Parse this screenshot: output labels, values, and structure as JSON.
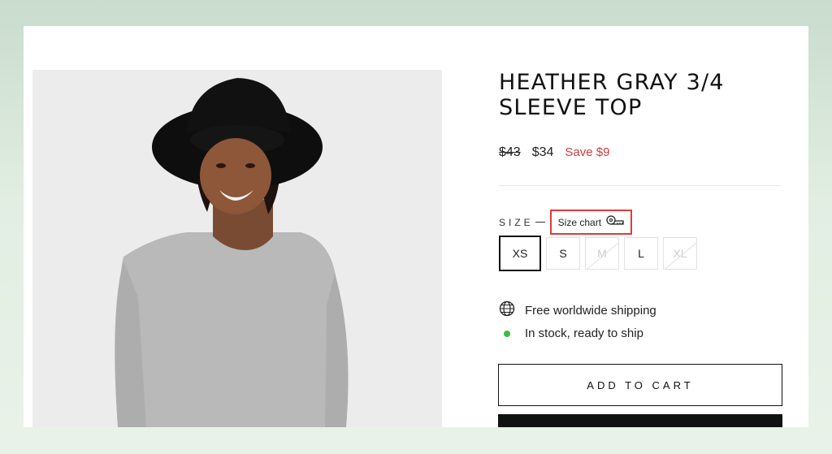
{
  "product": {
    "title": "HEATHER GRAY 3/4 SLEEVE TOP",
    "price_original": "$43",
    "price_current": "$34",
    "price_save": "Save $9",
    "save_color": "#d23b3b"
  },
  "size": {
    "label": "SIZE",
    "chart_link": "Size chart",
    "chart_icon": "measuring-tape-icon",
    "highlight_color": "#e03a3a",
    "options": [
      {
        "label": "XS",
        "state": "selected"
      },
      {
        "label": "S",
        "state": "available"
      },
      {
        "label": "M",
        "state": "unavailable"
      },
      {
        "label": "L",
        "state": "available"
      },
      {
        "label": "XL",
        "state": "unavailable"
      }
    ]
  },
  "features": {
    "shipping": {
      "icon": "globe-icon",
      "text": "Free worldwide shipping"
    },
    "stock": {
      "icon": "status-dot",
      "text": "In stock, ready to ship",
      "color": "#3dbd3d"
    }
  },
  "actions": {
    "add_to_cart": "ADD TO CART"
  }
}
